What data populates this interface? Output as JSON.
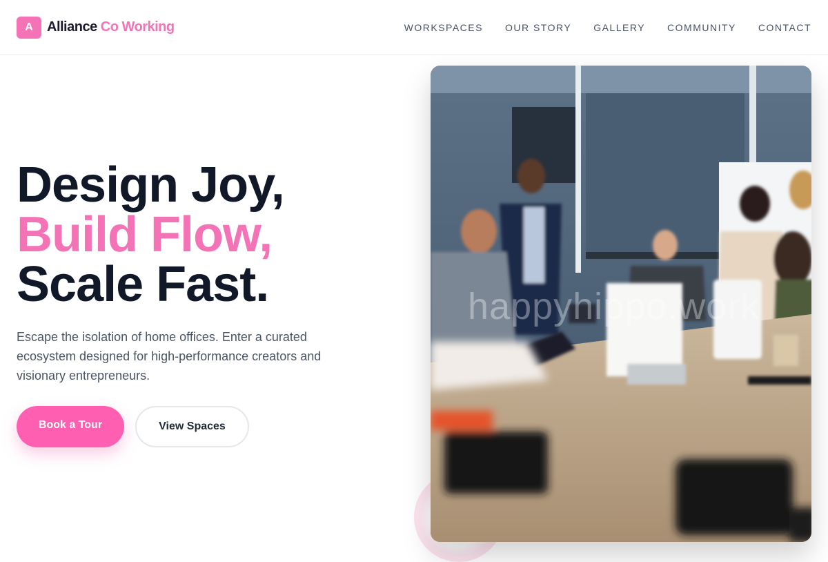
{
  "brand": {
    "mark": "A",
    "name_primary": "Alliance",
    "name_accent": "Co Working",
    "accent_color": "#f472b6"
  },
  "nav": {
    "items": [
      "WORKSPACES",
      "OUR STORY",
      "GALLERY",
      "COMMUNITY",
      "CONTACT"
    ]
  },
  "hero": {
    "line1": "Design Joy,",
    "line2": "Build Flow,",
    "line3": "Scale Fast.",
    "lead": "Escape the isolation of home offices. Enter a curated ecosystem designed for high-performance creators and visionary entrepreneurs.",
    "primary_cta": "Book a Tour",
    "secondary_cta": "View Spaces"
  },
  "image": {
    "watermark": "happyhippo.work"
  }
}
